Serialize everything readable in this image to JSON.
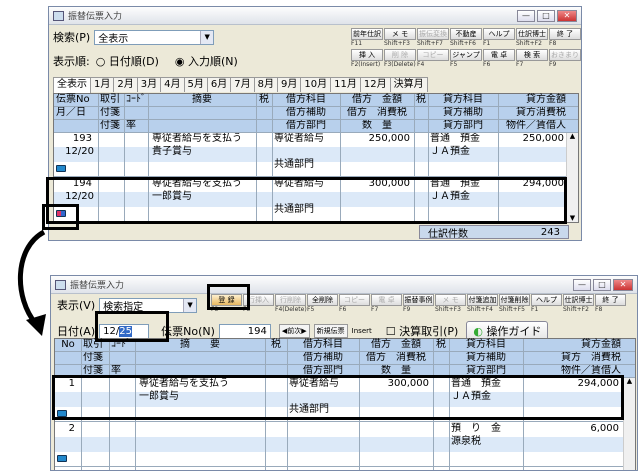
{
  "top": {
    "title": "振替伝票入力",
    "search_label": "検索(P)",
    "search_value": "全表示",
    "order_label": "表示順:",
    "order_date": "日付順(D)",
    "order_input": "入力順(N)",
    "fkeys": [
      {
        "label": "前年仕訳",
        "key": "F11",
        "dis": false
      },
      {
        "label": "メ モ",
        "key": "Shift+F3",
        "dis": false
      },
      {
        "label": "振伝変換",
        "key": "Shift+F7",
        "dis": true
      },
      {
        "label": "不動産",
        "key": "Shift+F6",
        "dis": false
      },
      {
        "label": "ヘルプ",
        "key": "F1",
        "dis": false
      },
      {
        "label": "仕訳博士",
        "key": "Shift+F2",
        "dis": false
      },
      {
        "label": "終 了",
        "key": "F8",
        "dis": false
      },
      {
        "label": "挿 入",
        "key": "F2(Insert)",
        "dis": false
      },
      {
        "label": "削 除",
        "key": "F3(Delete)",
        "dis": true
      },
      {
        "label": "コピー",
        "key": "F4",
        "dis": true
      },
      {
        "label": "ジャンプ",
        "key": "F5",
        "dis": false
      },
      {
        "label": "電 卓",
        "key": "F6",
        "dis": false
      },
      {
        "label": "検 索",
        "key": "F7",
        "dis": false
      },
      {
        "label": "おきまり",
        "key": "F9",
        "dis": true
      }
    ],
    "tabs": [
      "全表示",
      "1月",
      "2月",
      "3月",
      "4月",
      "5月",
      "6月",
      "7月",
      "8月",
      "9月",
      "10月",
      "11月",
      "12月",
      "決算月"
    ],
    "headers": {
      "col1": [
        "伝票No",
        "月／日"
      ],
      "col2": [
        "取引",
        "付箋",
        "付箋"
      ],
      "col3": [
        "ｺｰﾄﾞ",
        "",
        "率"
      ],
      "col4": "摘要",
      "col5": "税",
      "col6": [
        "借方科目",
        "借方補助",
        "借方部門"
      ],
      "col7": [
        "借方　金額",
        "借方　消費税",
        "数　量"
      ],
      "col8": "税",
      "col9": [
        "貸方科目",
        "貸方補助",
        "貸方部門"
      ],
      "col10": [
        "貸方金額",
        "貸方消費税",
        "物件／賃借人"
      ]
    },
    "rows": [
      {
        "no": "193",
        "date": "12/20",
        "desc1": "専従者給与を支払う",
        "desc2": "貴子賞与",
        "debit_acct": "専従者給与",
        "debit_dept": "共通部門",
        "debit_amt": "250,000",
        "credit_acct": "普通　預金",
        "credit_sub": "ＪＡ預金",
        "credit_amt": "250,000"
      },
      {
        "no": "194",
        "date": "12/20",
        "desc1": "専従者給与を支払う",
        "desc2": "一郎賞与",
        "debit_acct": "専従者給与",
        "debit_dept": "共通部門",
        "debit_amt": "300,000",
        "credit_acct": "普通　預金",
        "credit_sub": "ＪＡ預金",
        "credit_amt": "294,000"
      }
    ],
    "count_label": "仕訳件数",
    "count_value": "243"
  },
  "bottom": {
    "title": "振替伝票入力",
    "display_label": "表示(V)",
    "display_value": "検索指定",
    "fkeys": [
      {
        "label": "登 録",
        "key": "F3",
        "dis": false,
        "hot": true
      },
      {
        "label": "行挿入",
        "key": "F3",
        "dis": true
      },
      {
        "label": "行削除",
        "key": "F4(Delete)",
        "dis": true
      },
      {
        "label": "全削除",
        "key": "F5",
        "dis": false
      },
      {
        "label": "コピー",
        "key": "F6",
        "dis": true
      },
      {
        "label": "電 卓",
        "key": "F7",
        "dis": true
      },
      {
        "label": "振替事例",
        "key": "F9",
        "dis": false
      },
      {
        "label": "メ モ",
        "key": "Shift+F3",
        "dis": true
      },
      {
        "label": "付箋追加",
        "key": "Shift+F4",
        "dis": false
      },
      {
        "label": "付箋削除",
        "key": "Shift+F5",
        "dis": false
      },
      {
        "label": "ヘルプ",
        "key": "F1",
        "dis": false
      },
      {
        "label": "仕訳博士",
        "key": "Shift+F2",
        "dis": false
      },
      {
        "label": "終 了",
        "key": "F8",
        "dis": false
      }
    ],
    "date_label": "日付(A)",
    "date_value_month": "12/",
    "date_value_day": "25",
    "voucher_label": "伝票No(N)",
    "voucher_value": "194",
    "prev_next": "◀前次▶",
    "new_voucher": "新規伝票",
    "insert": "Insert",
    "closing_label": "決算取引(P)",
    "guide_button": "操作ガイド",
    "headers": {
      "col1": "No",
      "col2": [
        "取引",
        "付箋",
        "付箋"
      ],
      "col3": [
        "ｺｰﾄﾞ",
        "",
        "率"
      ],
      "col4": "摘　　要",
      "col5": "税",
      "col6": [
        "借方科目",
        "借方補助",
        "借方部門"
      ],
      "col7": [
        "借方　金額",
        "借方　消費税",
        "数　量"
      ],
      "col8": "税",
      "col9": [
        "貸方科目",
        "貸方補助",
        "貸方部門"
      ],
      "col10": [
        "貸方金額",
        "貸方　消費税",
        "物件／賃借人"
      ]
    },
    "rows": [
      {
        "no": "1",
        "desc1": "専従者給与を支払う",
        "desc2": "一郎賞与",
        "debit_acct": "専従者給与",
        "debit_dept": "共通部門",
        "debit_amt": "300,000",
        "credit_acct": "普通　預金",
        "credit_sub": "ＪＡ預金",
        "credit_amt": "294,000"
      },
      {
        "no": "2",
        "desc1": "",
        "desc2": "",
        "debit_acct": "",
        "debit_dept": "",
        "debit_amt": "",
        "credit_acct": "預　り　金",
        "credit_sub": "源泉税",
        "credit_amt": "6,000"
      }
    ]
  }
}
